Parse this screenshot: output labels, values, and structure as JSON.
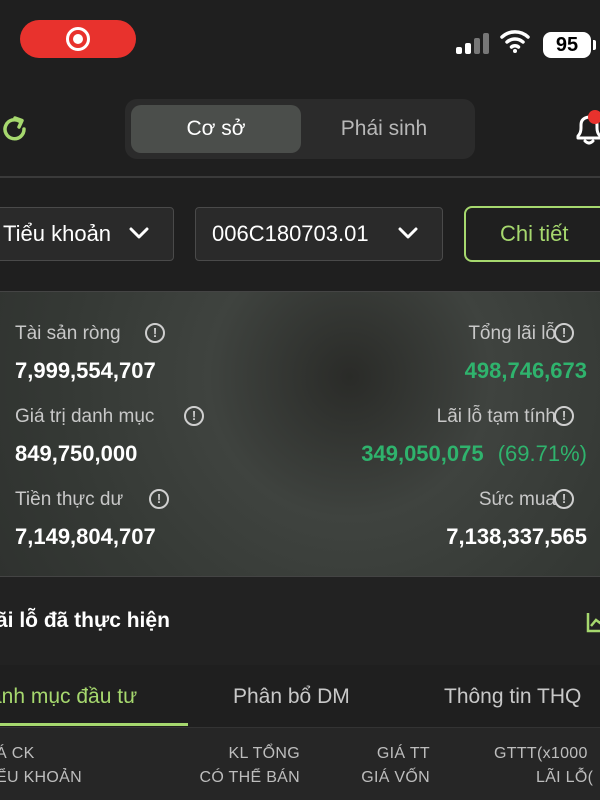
{
  "status_bar": {
    "battery": "95"
  },
  "header": {
    "segments": [
      "Cơ sở",
      "Phái sinh"
    ],
    "active_segment": "Cơ sở"
  },
  "selectors": {
    "sub_account": "Tiểu khoản",
    "account_number": "006C180703.01",
    "detail_button": "Chi tiết"
  },
  "summary": {
    "net_assets_label": "Tài sản ròng",
    "net_assets_value": "7,999,554,707",
    "total_pl_label": "Tổng lãi lỗ",
    "total_pl_value": "498,746,673",
    "portfolio_value_label": "Giá trị danh mục",
    "portfolio_value_value": "849,750,000",
    "temp_pl_label": "Lãi lỗ tạm tính",
    "temp_pl_value": "349,050,075",
    "temp_pl_percent": "(69.71%)",
    "cash_label": "Tiền thực dư",
    "cash_value": "7,149,804,707",
    "buying_power_label": "Sức mua",
    "buying_power_value": "7,138,337,565"
  },
  "realized": {
    "title": "ãi lỗ đã thực hiện"
  },
  "tabs": [
    "anh mục đầu tư",
    "Phân bổ DM",
    "Thông tin THQ"
  ],
  "table_header": {
    "col1_line1": "Á CK",
    "col1_line2": "ỂU KHOẢN",
    "col2_line1": "KL TỔNG",
    "col2_line2": "CÓ THỂ BÁN",
    "col3_line1": "GIÁ TT",
    "col3_line2": "GIÁ VỐN",
    "col4_line1": "GTTT(x1000",
    "col4_line2": "LÃI LỖ("
  },
  "colors": {
    "accent": "#a6d86e",
    "profit": "#2fb36d",
    "record": "#e8322d"
  }
}
